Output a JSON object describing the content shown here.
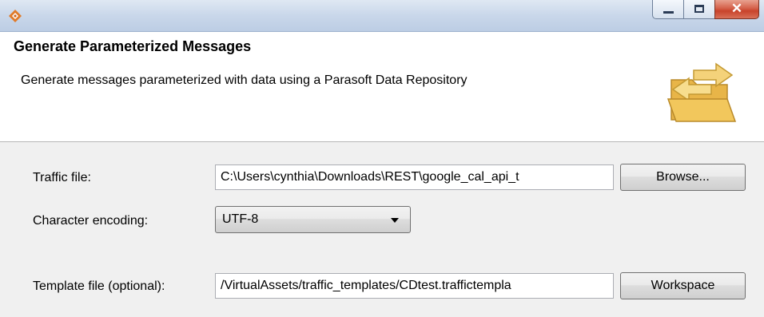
{
  "window": {
    "minimize_icon": "minimize-icon",
    "maximize_icon": "maximize-icon",
    "close_glyph": "✕"
  },
  "header": {
    "title": "Generate Parameterized Messages",
    "description": "Generate messages parameterized with data using a Parasoft Data Repository"
  },
  "form": {
    "traffic_file": {
      "label": "Traffic file:",
      "value": "C:\\Users\\cynthia\\Downloads\\REST\\google_cal_api_t",
      "button": "Browse..."
    },
    "encoding": {
      "label": "Character encoding:",
      "value": "UTF-8"
    },
    "template_file": {
      "label": "Template file (optional):",
      "value": "/VirtualAssets/traffic_templates/CDtest.traffictempla",
      "button": "Workspace"
    }
  },
  "colors": {
    "titlebar": "#c9d7ea",
    "close_button": "#c8432b",
    "form_background": "#f0f0f0"
  }
}
